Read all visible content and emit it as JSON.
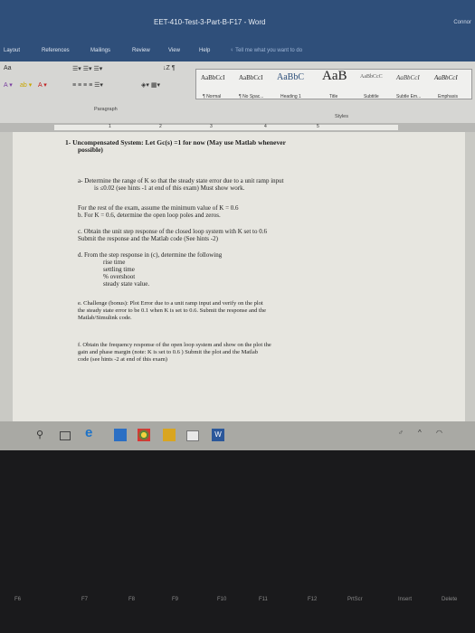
{
  "window": {
    "title": "EET-410-Test-3-Part-B-F17  -  Word",
    "account": "Connor"
  },
  "tabs": [
    "Layout",
    "References",
    "Mailings",
    "Review",
    "View",
    "Help"
  ],
  "tell_me": "Tell me what you want to do",
  "ribbon": {
    "styles": [
      {
        "sample": "AaBbCcI",
        "name": "¶ Normal"
      },
      {
        "sample": "AaBbCcI",
        "name": "¶ No Spac..."
      },
      {
        "sample": "AaBbC",
        "name": "Heading 1"
      },
      {
        "sample": "AaB",
        "name": "Title"
      },
      {
        "sample": "AaBbCcC",
        "name": "Subtitle"
      },
      {
        "sample": "AaBbCcI",
        "name": "Subtle Em..."
      },
      {
        "sample": "AaBbCcI",
        "name": "Emphasis"
      }
    ],
    "paragraph_label": "Paragraph",
    "styles_label": "Styles",
    "font_size_label": "Aa"
  },
  "ruler": {
    "marks": [
      "1",
      "2",
      "3",
      "4",
      "5"
    ]
  },
  "document": {
    "heading": "1- Uncompensated System: Let Gc(s) =1 for now  (May use Matlab whenever",
    "heading2": "possible)",
    "a1": "a- Determine the range of K so that the steady state error due to a unit ramp input",
    "a2": "is ≤0.02  (see hints -1 at end of this exam)  Must show work.",
    "r1": "For the rest of the exam, assume the minimum value of K = 0.6",
    "b": "b. For K = 0.6, determine the open loop poles and zeros.",
    "c1": "c. Obtain the unit step response of the closed loop system with K set to 0.6",
    "c2": "Submit the response and the Matlab code (See hints -2)",
    "d": "d. From the step response in (c), determine the following",
    "d_items": [
      "rise time",
      "settling time",
      "% overshoot",
      "steady state value."
    ],
    "e1": "e. Challenge (bonus): Plot Error due to a unit ramp input and verify on the plot",
    "e2": "the steady state error to be 0.1 when K is set to 0.6. Submit the response and the",
    "e3": "Matlab/Simulink code.",
    "f1": "f. Obtain the frequency response of the open loop system and show on the plot the",
    "f2": "gain and phase margin  (note: K is set to 0.6 )  Submit the plot and the Matlab",
    "f3": "code  (see hints -2  at end of this exam)"
  },
  "keyboard": [
    "F6",
    "F7",
    "F8",
    "F9",
    "F10",
    "F11",
    "F12",
    "PrtScr",
    "Insert",
    "Delete"
  ],
  "colors": {
    "titlebar": "#2f4f7a",
    "ribbon": "#d6d6d3",
    "page": "#e7e6e0",
    "bezel": "#1a1a1c"
  }
}
